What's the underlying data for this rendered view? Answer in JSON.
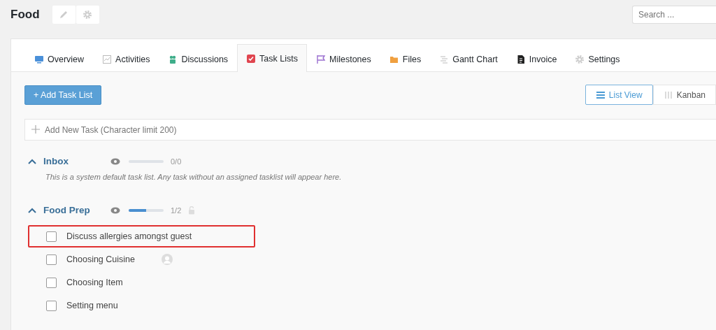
{
  "project": {
    "title": "Food"
  },
  "search": {
    "placeholder": "Search ..."
  },
  "tabs": [
    {
      "label": "Overview",
      "selected": false
    },
    {
      "label": "Activities",
      "selected": false
    },
    {
      "label": "Discussions",
      "selected": false
    },
    {
      "label": "Task Lists",
      "selected": true
    },
    {
      "label": "Milestones",
      "selected": false
    },
    {
      "label": "Files",
      "selected": false
    },
    {
      "label": "Gantt Chart",
      "selected": false
    },
    {
      "label": "Invoice",
      "selected": false
    },
    {
      "label": "Settings",
      "selected": false
    }
  ],
  "add_list_button": "+ Add Task List",
  "views": [
    {
      "label": "List View",
      "selected": true
    },
    {
      "label": "Kanban",
      "selected": false
    }
  ],
  "new_task": {
    "placeholder": "Add New Task (Character limit 200)"
  },
  "task_lists": [
    {
      "name": "Inbox",
      "expanded": true,
      "level": 0,
      "count": "0/0",
      "locked": false,
      "description": "This is a system default task list. Any task without an assigned tasklist will appear here."
    },
    {
      "name": "Food Prep",
      "expanded": true,
      "level": 0.5,
      "count": "1/2",
      "locked": true,
      "tasks": [
        {
          "title": "Discuss allergies amongst guest",
          "checked": false,
          "assignee": false,
          "highlighted": true
        },
        {
          "title": "Choosing Cuisine",
          "checked": false,
          "assignee": true,
          "highlighted": false
        },
        {
          "title": "Choosing Item",
          "checked": false,
          "assignee": false,
          "highlighted": false
        },
        {
          "title": "Setting menu",
          "checked": false,
          "assignee": false,
          "highlighted": false
        }
      ]
    }
  ]
}
